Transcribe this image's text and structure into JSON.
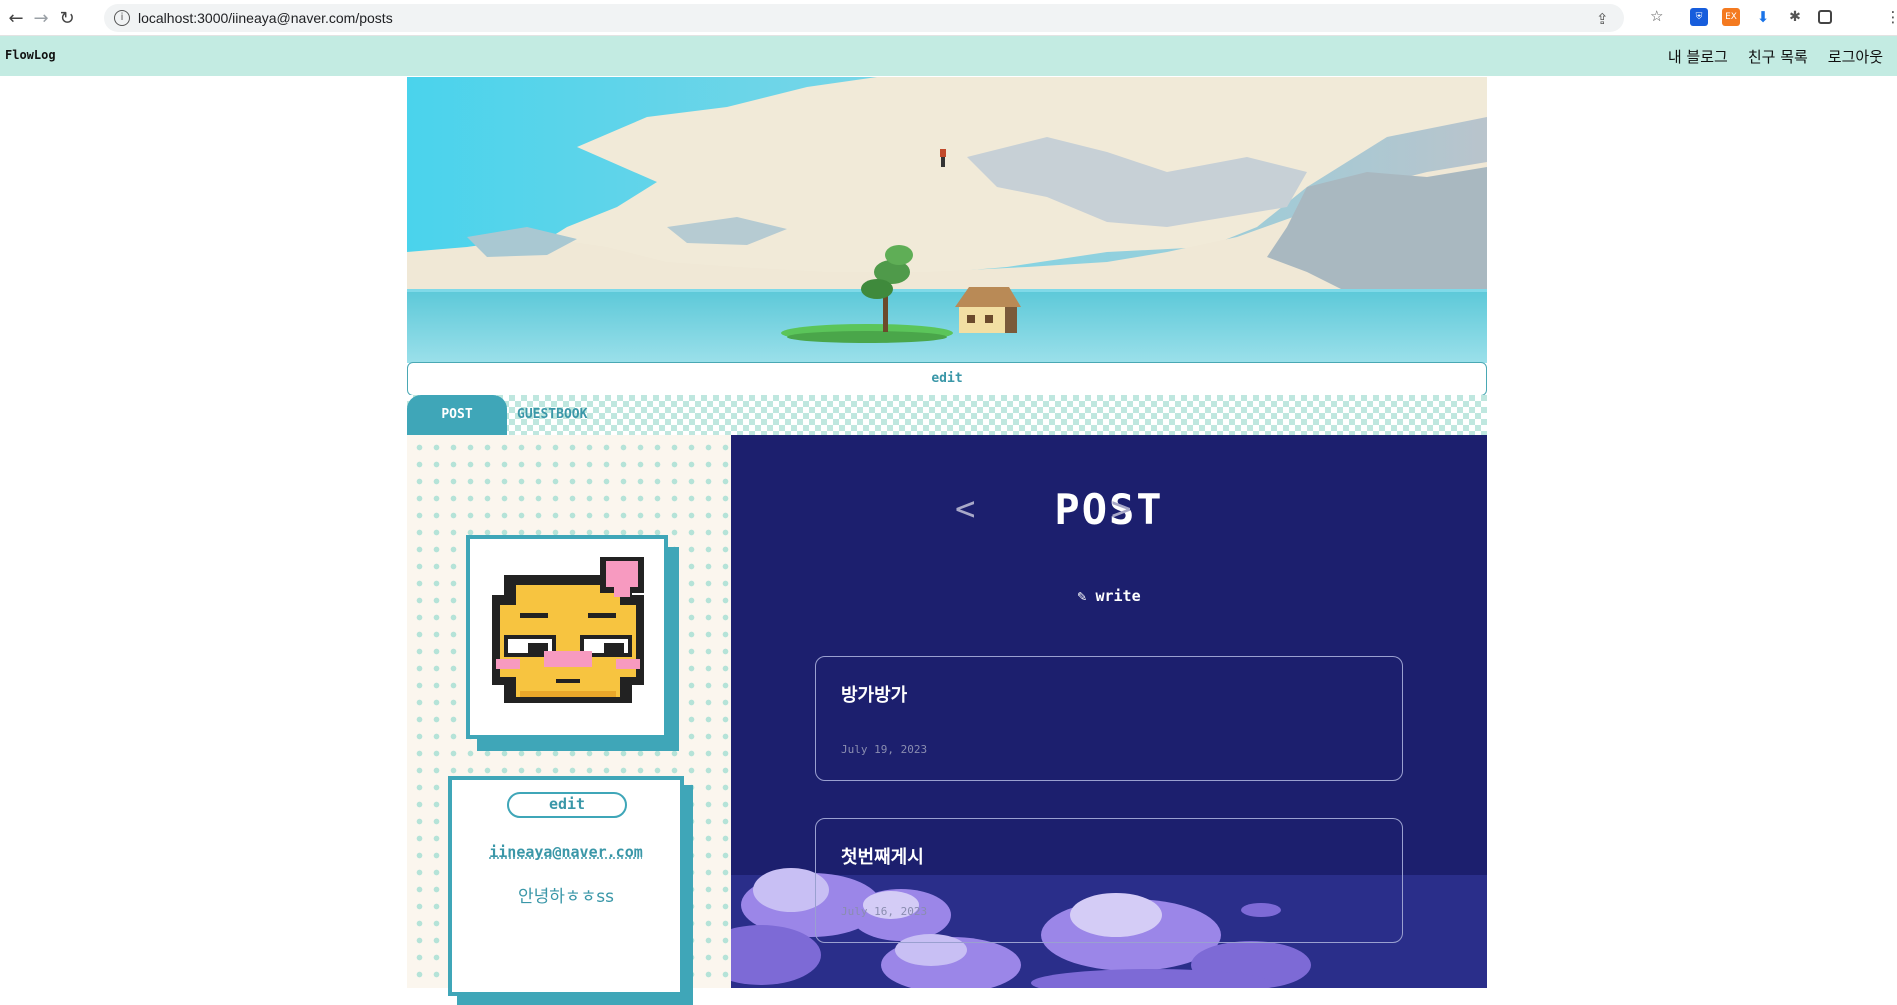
{
  "browser": {
    "url": "localhost:3000/iineaya@naver.com/posts",
    "icons": [
      "back-icon",
      "forward-icon",
      "reload-icon",
      "site-info-icon",
      "share-icon",
      "star-icon",
      "bitwarden-icon",
      "extension-icon",
      "download-icon",
      "puzzle-icon",
      "sidepanel-icon",
      "more-icon"
    ]
  },
  "appbar": {
    "brand": "FlowLog",
    "menu": [
      "내 블로그",
      "친구 목록",
      "로그아웃"
    ]
  },
  "banner": {
    "edit_label": "edit"
  },
  "tabs": {
    "post": "POST",
    "guestbook": "GUESTBOOK"
  },
  "profile": {
    "edit_label": "edit",
    "email": "iineaya@naver.com",
    "bio": "안녕하ㅎㅎss"
  },
  "posts": {
    "title": "POST",
    "prev_arrow": "<",
    "next_arrow": ">",
    "write_label": "✎ write",
    "items": [
      {
        "title": "방가방가",
        "date": "July 19, 2023"
      },
      {
        "title": "첫번째게시",
        "date": "July 16, 2023"
      }
    ]
  },
  "colors": {
    "appbar": "#c3ebe2",
    "accent": "#3fa6b8",
    "posts_bg": "#1c1f6e"
  }
}
